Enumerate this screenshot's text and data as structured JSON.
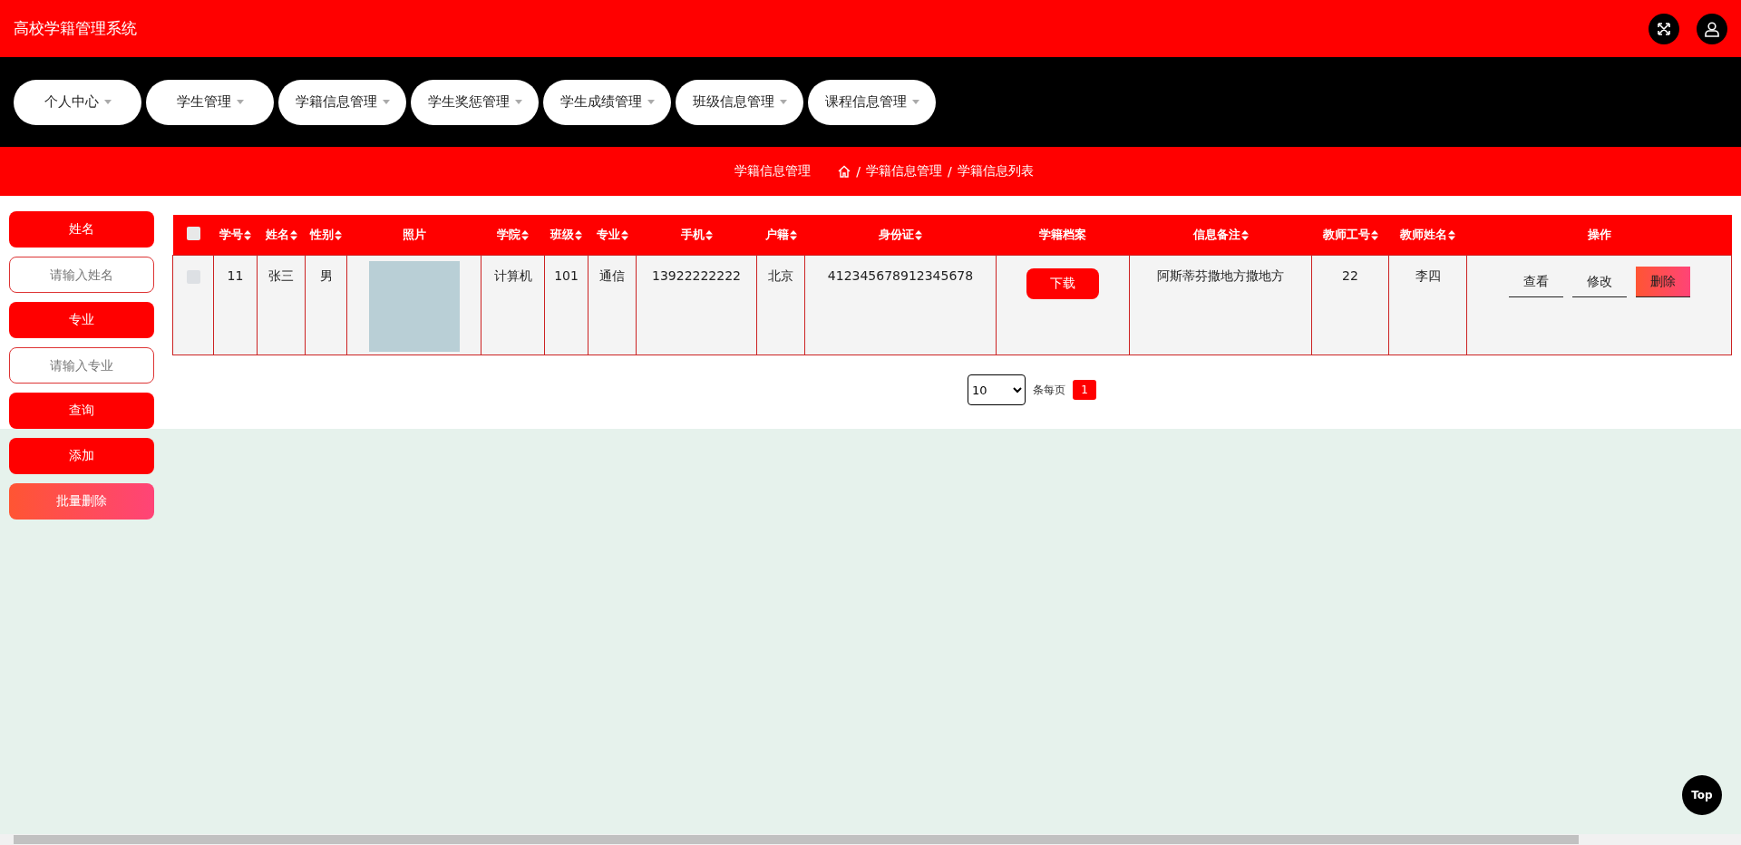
{
  "header": {
    "title": "高校学籍管理系统"
  },
  "nav": [
    {
      "label": "个人中心"
    },
    {
      "label": "学生管理"
    },
    {
      "label": "学籍信息管理"
    },
    {
      "label": "学生奖惩管理"
    },
    {
      "label": "学生成绩管理"
    },
    {
      "label": "班级信息管理"
    },
    {
      "label": "课程信息管理"
    }
  ],
  "breadcrumb": {
    "title": "学籍信息管理",
    "items": [
      {
        "separator": "/",
        "label": "学籍信息管理"
      },
      {
        "separator": "/",
        "label": "学籍信息列表"
      }
    ]
  },
  "sidebar": {
    "filters": [
      {
        "label": "姓名",
        "placeholder": "请输入姓名"
      },
      {
        "label": "专业",
        "placeholder": "请输入专业"
      }
    ],
    "buttons": [
      {
        "label": "查询",
        "kind": "primary"
      },
      {
        "label": "添加",
        "kind": "primary"
      },
      {
        "label": "批量删除",
        "kind": "danger"
      }
    ]
  },
  "table": {
    "select_all": {
      "checked": false
    },
    "columns": [
      {
        "label": "学号",
        "sortable": true
      },
      {
        "label": "姓名",
        "sortable": true
      },
      {
        "label": "性别",
        "sortable": true
      },
      {
        "label": "照片",
        "sortable": false
      },
      {
        "label": "学院",
        "sortable": true
      },
      {
        "label": "班级",
        "sortable": true
      },
      {
        "label": "专业",
        "sortable": true
      },
      {
        "label": "手机",
        "sortable": true
      },
      {
        "label": "户籍",
        "sortable": true
      },
      {
        "label": "身份证",
        "sortable": true
      },
      {
        "label": "学籍档案",
        "sortable": false
      },
      {
        "label": "信息备注",
        "sortable": true
      },
      {
        "label": "教师工号",
        "sortable": true
      },
      {
        "label": "教师姓名",
        "sortable": true
      },
      {
        "label": "操作",
        "sortable": false
      }
    ],
    "rows": [
      {
        "checked": false,
        "cells": [
          {
            "kind": "text",
            "text": "11"
          },
          {
            "kind": "text",
            "text": "张三"
          },
          {
            "kind": "text",
            "text": "男"
          },
          {
            "kind": "photo"
          },
          {
            "kind": "text",
            "text": "计算机"
          },
          {
            "kind": "text",
            "text": "101"
          },
          {
            "kind": "text",
            "text": "通信"
          },
          {
            "kind": "text",
            "text": "13922222222"
          },
          {
            "kind": "text",
            "text": "北京"
          },
          {
            "kind": "text",
            "text": "412345678912345678"
          },
          {
            "kind": "button",
            "text": "下载"
          },
          {
            "kind": "text",
            "text": "阿斯蒂芬撒地方撒地方"
          },
          {
            "kind": "text",
            "text": "22"
          },
          {
            "kind": "text",
            "text": "李四"
          },
          {
            "kind": "actions",
            "actions": [
              {
                "label": "查看",
                "kind": "plain"
              },
              {
                "label": "修改",
                "kind": "plain"
              },
              {
                "label": "删除",
                "kind": "danger"
              }
            ]
          }
        ]
      }
    ]
  },
  "pagination": {
    "page_size": "10",
    "per_page_label": "条每页",
    "pages": [
      {
        "label": "1",
        "selected": true
      }
    ]
  },
  "top_button": {
    "label": "Top"
  }
}
